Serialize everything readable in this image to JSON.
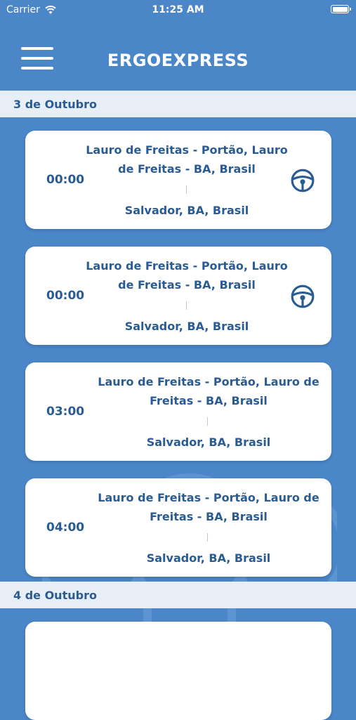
{
  "status_bar": {
    "carrier": "Carrier",
    "time": "11:25 AM"
  },
  "header": {
    "title": "ERGOEXPRESS"
  },
  "sections": [
    {
      "date": "3 de Outubro",
      "trips": [
        {
          "time": "00:00",
          "origin": "Lauro de Freitas - Portão, Lauro de Freitas - BA, Brasil",
          "destination": "Salvador, BA, Brasil",
          "icon": "steering-wheel-icon"
        },
        {
          "time": "00:00",
          "origin": "Lauro de Freitas - Portão, Lauro de Freitas - BA, Brasil",
          "destination": "Salvador, BA, Brasil",
          "icon": "steering-wheel-icon"
        },
        {
          "time": "03:00",
          "origin": "Lauro de Freitas - Portão, Lauro de Freitas - BA, Brasil",
          "destination": "Salvador, BA, Brasil"
        },
        {
          "time": "04:00",
          "origin": "Lauro de Freitas - Portão, Lauro de Freitas - BA, Brasil",
          "destination": "Salvador, BA, Brasil"
        }
      ]
    },
    {
      "date": "4 de Outubro",
      "trips": []
    }
  ],
  "colors": {
    "background": "#4a86c8",
    "accent": "#2a5c93",
    "section_bg": "#e8eef5"
  }
}
